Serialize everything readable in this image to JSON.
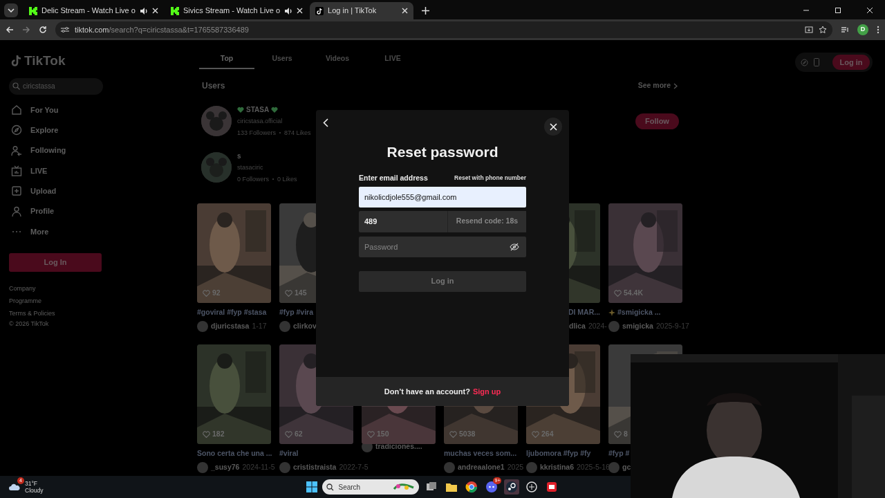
{
  "browser": {
    "tabs": [
      {
        "title": "Delic Stream - Watch Live o",
        "selected": false,
        "audio": true,
        "kind": "kick"
      },
      {
        "title": "Sivics Stream - Watch Live o",
        "selected": false,
        "audio": true,
        "kind": "kick"
      },
      {
        "title": "Log in | TikTok",
        "selected": true,
        "audio": false,
        "kind": "tiktok"
      }
    ],
    "url_host": "tiktok.com",
    "url_path": "/search?q=ciricstassa&t=1765587336489",
    "profile_initial": "D"
  },
  "sidebar": {
    "logo": "TikTok",
    "search": "ciricstassa",
    "nav": [
      {
        "label": "For You",
        "kind": "home"
      },
      {
        "label": "Explore",
        "kind": "compass"
      },
      {
        "label": "Following",
        "kind": "following"
      },
      {
        "label": "LIVE",
        "kind": "live"
      },
      {
        "label": "Upload",
        "kind": "upload"
      },
      {
        "label": "Profile",
        "kind": "profile"
      },
      {
        "label": "More",
        "kind": "more"
      }
    ],
    "login": "Log In",
    "footer": [
      "Company",
      "Programme",
      "Terms & Policies",
      "© 2026 TikTok"
    ]
  },
  "search_tabs": [
    {
      "label": "Top",
      "selected": true
    },
    {
      "label": "Users",
      "selected": false
    },
    {
      "label": "Videos",
      "selected": false
    },
    {
      "label": "LIVE",
      "selected": false
    }
  ],
  "header_login": "Log in",
  "users": {
    "title": "Users",
    "see_more": "See more",
    "follow": "Follow",
    "rows": [
      {
        "name": "STASA",
        "hearts": true,
        "handle": "ciricstasa.official",
        "stats": [
          "133 Followers",
          "874 Likes"
        ]
      },
      {
        "name": "s",
        "hearts": false,
        "handle": "stasaciric",
        "stats": [
          "0 Followers",
          "0 Likes"
        ]
      }
    ]
  },
  "videos": [
    [
      {
        "likes": "92",
        "caption": "#goviral #fyp #stasa",
        "author": "djuricstasa",
        "date": "1-17"
      },
      {
        "likes": "145",
        "caption": "#fyp #vira",
        "author": "clirkov"
      },
      {
        "caption": "DI MAR...",
        "author": "dlica",
        "date": "2024-",
        "clipped_left": true
      },
      {
        "likes": "54.4K",
        "caption": "#smigicka ...",
        "sparkle": true,
        "author": "smigicka",
        "date": "2025-9-17"
      }
    ],
    [
      {
        "likes": "182",
        "caption": "Sono certa che una ...",
        "author": "_susy76",
        "date": "2024-11-5"
      },
      {
        "likes": "62",
        "caption": "#viral",
        "author": "crististraista",
        "date": "2022-7-5"
      },
      {
        "likes": "150",
        "author": "tradiciones....",
        "raised": true
      },
      {
        "likes": "5038",
        "caption": "muchas veces som...",
        "author": "andreaalone1",
        "date": "2025"
      },
      {
        "likes": "264",
        "caption": "ljubomora #fyp #fy",
        "author": "kkristina6",
        "date": "2025-5-16"
      },
      {
        "likes": "8",
        "caption": "#fyp #",
        "author": "gc"
      }
    ]
  ],
  "dialog": {
    "title": "Reset password",
    "email_label": "Enter email address",
    "phone_link": "Reset with phone number",
    "email": "nikolicdjole555@gmail.com",
    "code": "489",
    "resend": "Resend code: 18s",
    "password_placeholder": "Password",
    "submit": "Log in",
    "submit_disabled": true,
    "footer_text": "Don’t have an account?",
    "signup": "Sign up"
  },
  "taskbar": {
    "temperature": "31°F",
    "weather": "Cloudy",
    "weather_badge": "4",
    "search": "Search",
    "discord_badge": "9+"
  }
}
